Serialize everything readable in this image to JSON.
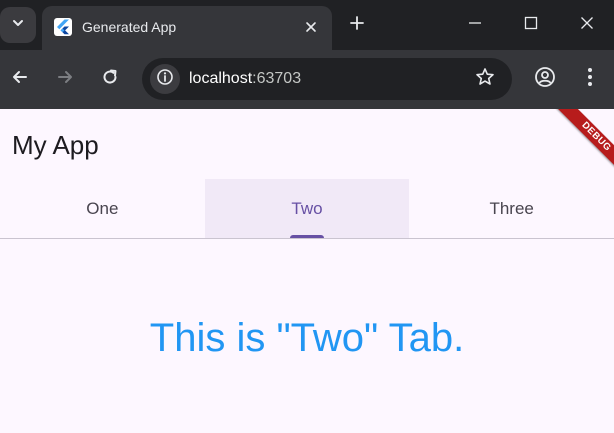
{
  "browser": {
    "tab_title": "Generated App",
    "url_host": "localhost",
    "url_port": ":63703"
  },
  "app": {
    "title": "My App",
    "debug_banner": "DEBUG",
    "tabs": [
      {
        "label": "One",
        "selected": false
      },
      {
        "label": "Two",
        "selected": true
      },
      {
        "label": "Three",
        "selected": false
      }
    ],
    "body_text": "This is \"Two\" Tab."
  },
  "colors": {
    "primary": "#6750a4",
    "body_text": "#2196f3",
    "selected_tab_bg": "#f1e9f7",
    "debug_banner": "#b71c1c"
  },
  "icons": {
    "tab_search": "chevron-down-icon",
    "favicon": "flutter-logo-icon",
    "tab_close": "close-icon",
    "new_tab": "plus-icon",
    "minimize": "minimize-icon",
    "maximize": "maximize-icon",
    "close_window": "close-icon",
    "back": "arrow-left-icon",
    "forward": "arrow-right-icon",
    "reload": "reload-icon",
    "site_info": "info-icon",
    "bookmark": "star-icon",
    "profile": "profile-icon",
    "menu": "kebab-menu-icon"
  }
}
